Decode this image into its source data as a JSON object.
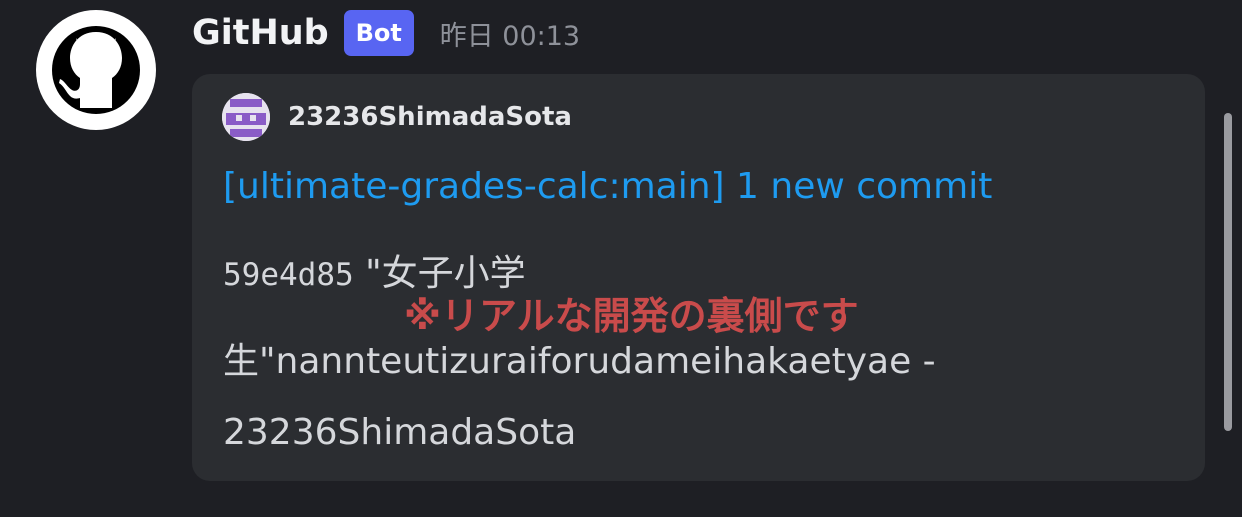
{
  "message": {
    "author": "GitHub",
    "badge": "Bot",
    "timestamp": "昨日 00:13",
    "avatar_icon": "github-octocat-icon"
  },
  "embed": {
    "author_name": "23236ShimadaSota",
    "author_avatar_icon": "identicon-avatar",
    "title": "[ultimate-grades-calc:main] 1 new commit",
    "description": {
      "hash": "59e4d85",
      "line1_text": " \"女子小学",
      "line2_text": "生\"nannteutizuraiforudameihakaetyae -",
      "line3_text": "23236ShimadaSota"
    },
    "title_color": "#1e9bf0"
  },
  "overlay_note": "※リアルな開発の裏側です",
  "colors": {
    "background": "#1e1f24",
    "embed_background": "#2b2d31",
    "badge": "#5865f2",
    "overlay_note": "#c94b4b"
  }
}
